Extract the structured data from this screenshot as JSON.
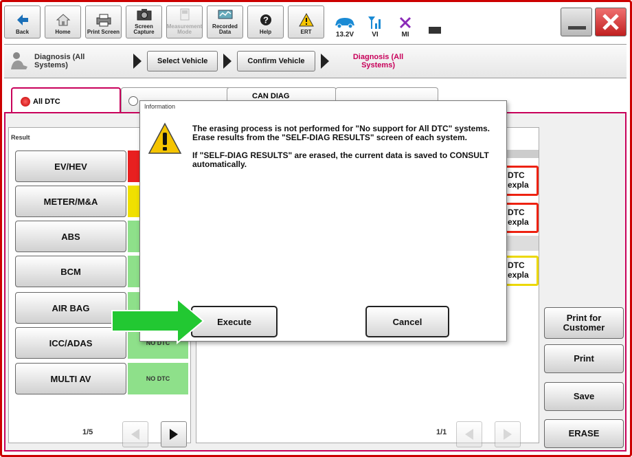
{
  "toolbar": {
    "back": "Back",
    "home": "Home",
    "print_screen": "Print Screen",
    "screen_capture": "Screen Capture",
    "measurement_mode": "Measurement Mode",
    "recorded_data": "Recorded Data",
    "help": "Help",
    "ert": "ERT",
    "voltage": "13.2V",
    "vi": "VI",
    "mi": "MI"
  },
  "breadcrumb": {
    "first": "Diagnosis (All Systems)",
    "select_vehicle": "Select Vehicle",
    "confirm_vehicle": "Confirm Vehicle",
    "current": "Diagnosis (All Systems)"
  },
  "tabs": {
    "all_dtc": "All DTC",
    "can_diag": "CAN DIAG"
  },
  "result_label": "Result",
  "systems": [
    {
      "name": "EV/HEV",
      "status": ""
    },
    {
      "name": "METER/M&A",
      "status": ""
    },
    {
      "name": "ABS",
      "status": ""
    },
    {
      "name": "BCM",
      "status": ""
    },
    {
      "name": "AIR BAG",
      "status": ""
    },
    {
      "name": "ICC/ADAS",
      "status": "NO DTC"
    },
    {
      "name": "MULTI AV",
      "status": "NO DTC"
    }
  ],
  "dtc_buttons": [
    "DTC expla",
    "DTC expla",
    "DTC expla"
  ],
  "side": {
    "print_customer": "Print for Customer",
    "print": "Print",
    "save": "Save",
    "erase": "ERASE"
  },
  "pager_left": "1/5",
  "pager_right": "1/1",
  "dialog": {
    "title": "Information",
    "message1": "The erasing process is not performed for \"No support for All DTC\" systems. Erase results from the \"SELF-DIAG RESULTS\" screen of each system.",
    "message2": "If \"SELF-DIAG RESULTS\" are erased, the current data is saved to CONSULT automatically.",
    "execute": "Execute",
    "cancel": "Cancel"
  },
  "colors": {
    "accent": "#c8005a",
    "red": "#e82020",
    "yellow": "#f0e000",
    "green": "#8ee08a",
    "pointer": "#22c832"
  }
}
